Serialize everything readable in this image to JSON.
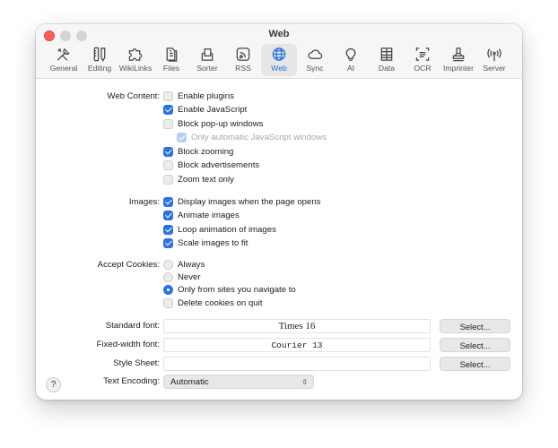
{
  "window": {
    "title": "Web"
  },
  "toolbar": {
    "items": [
      {
        "label": "General",
        "icon": "tools-icon"
      },
      {
        "label": "Editing",
        "icon": "pencil-ruler-icon"
      },
      {
        "label": "WikiLinks",
        "icon": "puzzle-icon"
      },
      {
        "label": "Files",
        "icon": "documents-icon"
      },
      {
        "label": "Sorter",
        "icon": "sorter-icon"
      },
      {
        "label": "RSS",
        "icon": "rss-icon"
      },
      {
        "label": "Web",
        "icon": "globe-icon",
        "active": true
      },
      {
        "label": "Sync",
        "icon": "cloud-icon"
      },
      {
        "label": "AI",
        "icon": "lightbulb-icon"
      },
      {
        "label": "Data",
        "icon": "data-grid-icon"
      },
      {
        "label": "OCR",
        "icon": "ocr-icon"
      },
      {
        "label": "Imprinter",
        "icon": "stamp-icon"
      },
      {
        "label": "Server",
        "icon": "antenna-icon"
      }
    ]
  },
  "web_content": {
    "label": "Web Content:",
    "options": [
      {
        "label": "Enable plugins",
        "checked": false
      },
      {
        "label": "Enable JavaScript",
        "checked": true
      },
      {
        "label": "Block pop-up windows",
        "checked": false
      },
      {
        "label": "Only automatic JavaScript windows",
        "checked": true,
        "disabled": true
      },
      {
        "label": "Block zooming",
        "checked": true
      },
      {
        "label": "Block advertisements",
        "checked": false
      },
      {
        "label": "Zoom text only",
        "checked": false
      }
    ]
  },
  "images": {
    "label": "Images:",
    "options": [
      {
        "label": "Display images when the page opens",
        "checked": true
      },
      {
        "label": "Animate images",
        "checked": true
      },
      {
        "label": "Loop animation of images",
        "checked": true
      },
      {
        "label": "Scale images to fit",
        "checked": true
      }
    ]
  },
  "cookies": {
    "label": "Accept Cookies:",
    "options": [
      {
        "label": "Always",
        "selected": false
      },
      {
        "label": "Never",
        "selected": false
      },
      {
        "label": "Only from sites you navigate to",
        "selected": true
      }
    ],
    "delete_on_quit": {
      "label": "Delete cookies on quit",
      "checked": false
    }
  },
  "fonts": {
    "standard": {
      "label": "Standard font:",
      "value": "Times 16",
      "button": "Select..."
    },
    "fixed": {
      "label": "Fixed-width font:",
      "value": "Courier 13",
      "button": "Select..."
    },
    "stylesheet": {
      "label": "Style Sheet:",
      "value": "",
      "button": "Select..."
    }
  },
  "encoding": {
    "label": "Text Encoding:",
    "value": "Automatic"
  },
  "help": {
    "label": "?"
  },
  "colors": {
    "accent": "#2b73e0",
    "close": "#ff5f57"
  }
}
